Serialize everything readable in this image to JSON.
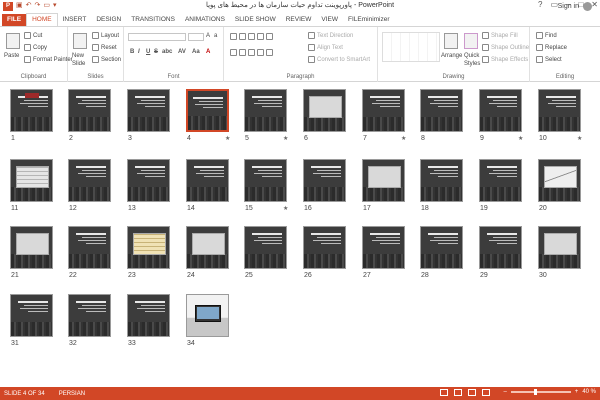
{
  "window": {
    "title": "پاورپوینت تداوم حیات سازمان ها در محیط های پویا - PowerPoint",
    "logo_letter": "P",
    "qat_icons": [
      "save-icon",
      "undo-icon",
      "redo-icon",
      "present-icon",
      "customize-icon"
    ],
    "controls": {
      "help": "?",
      "restore": "▭",
      "minimize": "–",
      "maximize": "□",
      "close": "✕"
    }
  },
  "tabs": [
    {
      "label": "FILE"
    },
    {
      "label": "HOME"
    },
    {
      "label": "INSERT"
    },
    {
      "label": "DESIGN"
    },
    {
      "label": "TRANSITIONS"
    },
    {
      "label": "ANIMATIONS"
    },
    {
      "label": "SLIDE SHOW"
    },
    {
      "label": "REVIEW"
    },
    {
      "label": "VIEW"
    },
    {
      "label": "FILEminimizer"
    }
  ],
  "active_tab": "HOME",
  "sign_in": "Sign in",
  "ribbon": {
    "clipboard": {
      "label": "Clipboard",
      "paste": "Paste",
      "cut": "Cut",
      "copy": "Copy",
      "format_painter": "Format Painter"
    },
    "slides": {
      "label": "Slides",
      "new_slide": "New",
      "new_slide2": "Slide",
      "layout": "Layout",
      "reset": "Reset",
      "section": "Section"
    },
    "font": {
      "label": "Font",
      "bold": "B",
      "italic": "I",
      "underline": "U",
      "strike": "S",
      "shadow": "abc",
      "spacing": "AV",
      "case": "Aa",
      "color": "A"
    },
    "paragraph": {
      "label": "Paragraph",
      "text_direction": "Text Direction",
      "align_text": "Align Text",
      "convert_smartart": "Convert to SmartArt"
    },
    "drawing": {
      "label": "Drawing",
      "arrange": "Arrange",
      "quick_styles": "Quick",
      "quick_styles2": "Styles",
      "shape_fill": "Shape Fill",
      "shape_outline": "Shape Outline",
      "shape_effects": "Shape Effects"
    },
    "editing": {
      "label": "Editing",
      "find": "Find",
      "replace": "Replace",
      "select": "Select"
    }
  },
  "slides": [
    {
      "n": "1",
      "kind": "title",
      "star": ""
    },
    {
      "n": "2",
      "kind": "text",
      "star": ""
    },
    {
      "n": "3",
      "kind": "text",
      "star": ""
    },
    {
      "n": "4",
      "kind": "text",
      "star": "★",
      "selected": true
    },
    {
      "n": "5",
      "kind": "text",
      "star": "★"
    },
    {
      "n": "6",
      "kind": "box",
      "star": ""
    },
    {
      "n": "7",
      "kind": "text",
      "star": "★"
    },
    {
      "n": "8",
      "kind": "text",
      "star": ""
    },
    {
      "n": "9",
      "kind": "text",
      "star": "★"
    },
    {
      "n": "10",
      "kind": "text",
      "star": "★"
    },
    {
      "n": "11",
      "kind": "grid",
      "star": ""
    },
    {
      "n": "12",
      "kind": "text",
      "star": ""
    },
    {
      "n": "13",
      "kind": "text",
      "star": ""
    },
    {
      "n": "14",
      "kind": "text",
      "star": ""
    },
    {
      "n": "15",
      "kind": "text",
      "star": "★"
    },
    {
      "n": "16",
      "kind": "text",
      "star": ""
    },
    {
      "n": "17",
      "kind": "box",
      "star": ""
    },
    {
      "n": "18",
      "kind": "text",
      "star": ""
    },
    {
      "n": "19",
      "kind": "text",
      "star": ""
    },
    {
      "n": "20",
      "kind": "chart",
      "star": ""
    },
    {
      "n": "21",
      "kind": "box",
      "star": ""
    },
    {
      "n": "22",
      "kind": "text",
      "star": ""
    },
    {
      "n": "23",
      "kind": "tbl",
      "star": ""
    },
    {
      "n": "24",
      "kind": "box",
      "star": ""
    },
    {
      "n": "25",
      "kind": "text",
      "star": ""
    },
    {
      "n": "26",
      "kind": "text",
      "star": ""
    },
    {
      "n": "27",
      "kind": "text",
      "star": ""
    },
    {
      "n": "28",
      "kind": "text",
      "star": ""
    },
    {
      "n": "29",
      "kind": "text",
      "star": ""
    },
    {
      "n": "30",
      "kind": "box",
      "star": ""
    },
    {
      "n": "31",
      "kind": "text",
      "star": ""
    },
    {
      "n": "32",
      "kind": "text",
      "star": ""
    },
    {
      "n": "33",
      "kind": "text",
      "star": ""
    },
    {
      "n": "34",
      "kind": "photo",
      "star": ""
    }
  ],
  "status": {
    "slide_of": "SLIDE 4 OF 34",
    "language": "PERSIAN",
    "zoom": "40 %",
    "zoom_minus": "–",
    "zoom_plus": "+",
    "zoom_fraction": 0.4
  },
  "colors": {
    "accent": "#d24726"
  }
}
